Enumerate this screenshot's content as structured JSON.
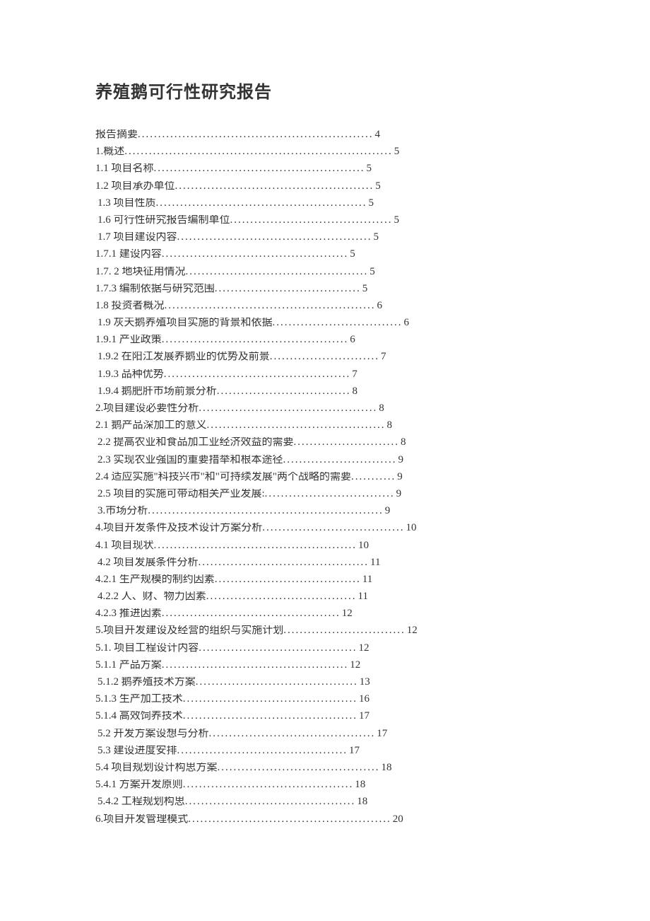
{
  "title": "养殖鹅可行性研究报告",
  "toc": [
    {
      "text": "报告摘要",
      "dots": "..........................................................",
      "page": " 4",
      "indent": 0
    },
    {
      "text": "1.概述",
      "dots": "..................................................................",
      "page": " 5",
      "indent": 0
    },
    {
      "text": "1.1 项目名称",
      "dots": "....................................................",
      "page": " 5",
      "indent": 0
    },
    {
      "text": "1.2 项目承办单位",
      "dots": ".................................................",
      "page": " 5",
      "indent": 0
    },
    {
      "text": "1.3 项目性质",
      "dots": "....................................................",
      "page": " 5",
      "indent": 1
    },
    {
      "text": "1.6 可行性研究报告编制单位",
      "dots": "........................................",
      "page": " 5",
      "indent": 1
    },
    {
      "text": "1.7 项目建设内容",
      "dots": "................................................",
      "page": " 5",
      "indent": 1
    },
    {
      "text": "1.7.1 建设内容 ",
      "dots": "..............................................",
      "page": " 5",
      "indent": 0
    },
    {
      "text": "1.7. 2 地块征用情况",
      "dots": ".............................................",
      "page": " 5",
      "indent": 0
    },
    {
      "text": "1.7.3 编制依据与研究范围 ",
      "dots": "....................................",
      "page": " 5",
      "indent": 0
    },
    {
      "text": "1.8 投资者概况",
      "dots": "....................................................",
      "page": " 6",
      "indent": 0
    },
    {
      "text": "1.9 灰天鹅养殖项目实施的背景和依据",
      "dots": "................................",
      "page": " 6",
      "indent": 1
    },
    {
      "text": "1.9.1 产业政策 ",
      "dots": "..............................................",
      "page": " 6",
      "indent": 0
    },
    {
      "text": "1.9.2 在阳江发展养鹅业的优势及前景 ",
      "dots": "...........................",
      "page": " 7",
      "indent": 1
    },
    {
      "text": "1.9.3 品种优势 ",
      "dots": "..............................................",
      "page": " 7",
      "indent": 1
    },
    {
      "text": "1.9.4 鹅肥肝市场前景分析 ",
      "dots": ".................................",
      "page": " 8",
      "indent": 1
    },
    {
      "text": "2.项目建设必要性分析",
      "dots": "............................................",
      "page": " 8",
      "indent": 0
    },
    {
      "text": "2.1 鹅产品深加工的意义",
      "dots": "............................................",
      "page": " 8",
      "indent": 0
    },
    {
      "text": "2.2 提高农业和食品加工业经济效益的需要",
      "dots": "..........................",
      "page": " 8",
      "indent": 1
    },
    {
      "text": "2.3 实现农业强国的重要措举和根本途径",
      "dots": "............................",
      "page": " 9",
      "indent": 1
    },
    {
      "text": "2.4 适应实施\"科技兴市\"和\"可持续发展\"两个战略的需要",
      "dots": "...........",
      "page": " 9",
      "indent": 0
    },
    {
      "text": "2.5 项目的实施可带动相关产业发展:",
      "dots": "................................",
      "page": " 9",
      "indent": 1
    },
    {
      "text": "3.市场分析",
      "dots": "..........................................................",
      "page": " 9",
      "indent": 1
    },
    {
      "text": "4.项目开发条件及技术设计方案分析",
      "dots": "...................................",
      "page": " 10",
      "indent": 0
    },
    {
      "text": "4.1 项目现状 ",
      "dots": "..................................................",
      "page": " 10",
      "indent": 0
    },
    {
      "text": "4.2 项目发展条件分析 ",
      "dots": "..........................................",
      "page": " 11",
      "indent": 1
    },
    {
      "text": "4.2.1 生产规模的制约因素 ",
      "dots": "....................................",
      "page": " 11",
      "indent": 0
    },
    {
      "text": "4.2.2 人、财、物力因素 ",
      "dots": ".....................................",
      "page": " 11",
      "indent": 1
    },
    {
      "text": "4.2.3 推进因素 ",
      "dots": "............................................",
      "page": " 12",
      "indent": 0
    },
    {
      "text": "5.项目开发建设及经营的组织与实施计划",
      "dots": "..............................",
      "page": " 12",
      "indent": 0
    },
    {
      "text": "5.1. 项目工程设计内容 ",
      "dots": ".......................................",
      "page": " 12",
      "indent": 0
    },
    {
      "text": "5.1.1 产品方案 ",
      "dots": "..............................................",
      "page": " 12",
      "indent": 0
    },
    {
      "text": "5.1.2 鹅养殖技术方案 ",
      "dots": "........................................",
      "page": " 13",
      "indent": 1
    },
    {
      "text": "5.1.3 生产加工技术 ",
      "dots": "...........................................",
      "page": " 16",
      "indent": 0
    },
    {
      "text": "5.1.4 高效饲养技术 ",
      "dots": "...........................................",
      "page": " 17",
      "indent": 0
    },
    {
      "text": "5.2 开发方案设想与分析 ",
      "dots": ".........................................",
      "page": " 17",
      "indent": 1
    },
    {
      "text": "5.3 建设进度安排 ",
      "dots": "..........................................",
      "page": " 17",
      "indent": 1
    },
    {
      "text": "5.4 项目规划设计构思方案",
      "dots": "........................................",
      "page": " 18",
      "indent": 0
    },
    {
      "text": "5.4.1 方案开发原则 ",
      "dots": "..........................................",
      "page": " 18",
      "indent": 0
    },
    {
      "text": "5.4.2 工程规划构思 ",
      "dots": "..........................................",
      "page": " 18",
      "indent": 1
    },
    {
      "text": "6.项目开发管理模式",
      "dots": "..................................................",
      "page": " 20",
      "indent": 0
    }
  ]
}
